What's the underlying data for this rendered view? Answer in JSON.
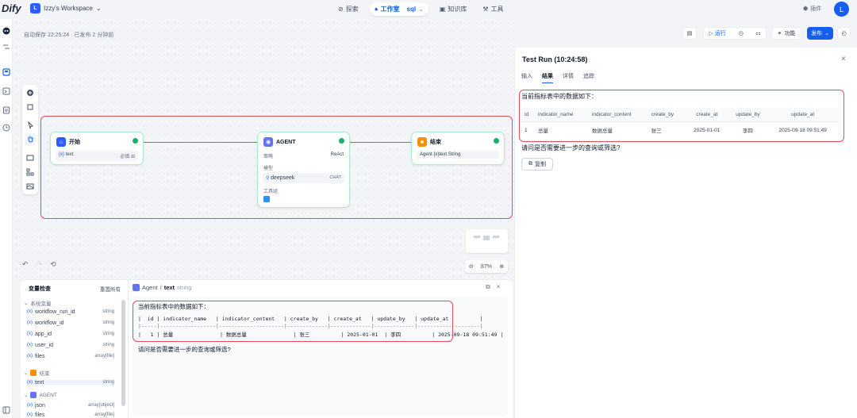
{
  "topbar": {
    "logo": "Dify",
    "workspace_initial": "L",
    "workspace_name": "Izzy's Workspace",
    "nav": [
      {
        "label": "探索"
      },
      {
        "label": "工作室",
        "active": true
      },
      {
        "label": "知识库"
      },
      {
        "label": "工具"
      }
    ],
    "app_name": "sql",
    "plugin_label": "插件",
    "user_initial": "L"
  },
  "canvas": {
    "autosave": "自动保存 22:25:24 · 已发布 2 分钟前",
    "zoom": "87%",
    "nodes": {
      "start": {
        "title": "开始",
        "var_name": "text",
        "var_type": "必填 ⊞"
      },
      "agent": {
        "title": "AGENT",
        "strategy_label": "策略",
        "strategy_value": "ReAct",
        "model_label": "模型",
        "model_name": "deepseek",
        "model_badge": "CHAT",
        "tools_label": "工具组"
      },
      "end": {
        "title": "结束",
        "output": "Agent {x}text String"
      }
    }
  },
  "toolbar": {
    "run_label": "运行",
    "features_label": "功能",
    "publish_label": "发布"
  },
  "test_run": {
    "title": "Test Run (10:24:58)",
    "tabs": [
      "输入",
      "结果",
      "详情",
      "追踪"
    ],
    "active_tab": "结果",
    "intro": "当前指标表中的数据如下：",
    "table": {
      "headers": [
        "id",
        "indicator_name",
        "indicator_content",
        "create_by",
        "create_at",
        "update_by",
        "update_at"
      ],
      "rows": [
        [
          "1",
          "总量",
          "数据总量",
          "张三",
          "2025-01-01",
          "李四",
          "2025-09-18 09:51:49"
        ]
      ]
    },
    "question": "请问是否需要进一步的查询或筛选?",
    "copy_label": "复制"
  },
  "inspector": {
    "title": "变量检查",
    "reset_label": "重置所有",
    "groups": [
      {
        "name": "系统变量",
        "vars": [
          {
            "name": "workflow_run_id",
            "type": "string"
          },
          {
            "name": "workflow_id",
            "type": "string"
          },
          {
            "name": "app_id",
            "type": "string"
          },
          {
            "name": "user_id",
            "type": "string"
          },
          {
            "name": "files",
            "type": "array[file]"
          }
        ]
      },
      {
        "name": "结束",
        "vars": [
          {
            "name": "text",
            "type": "string"
          }
        ]
      },
      {
        "name": "AGENT",
        "vars": [
          {
            "name": "json",
            "type": "array[object]"
          },
          {
            "name": "files",
            "type": "array[file]"
          }
        ]
      }
    ],
    "breadcrumb_node": "Agent",
    "breadcrumb_var": "text",
    "breadcrumb_type": "string",
    "content_intro": "当前指标表中的数据如下：",
    "content_header": "|  id | indicator_name   | indicator_content   | create_by   | create_at   | update_by   | update_at          |",
    "content_sep": "|-----|------------------|---------------------|-------------|-------------|-------------|--------------------|",
    "content_row": "|   1 | 总量               | 数据总量               | 张三          | 2025-01-01  | 李四          | 2025-09-18 09:51:49 |",
    "content_question": "请问是否需要进一步的查询或筛选?"
  },
  "colors": {
    "accent": "#155eef",
    "success": "#17b26a",
    "highlight": "#e04f5f"
  }
}
